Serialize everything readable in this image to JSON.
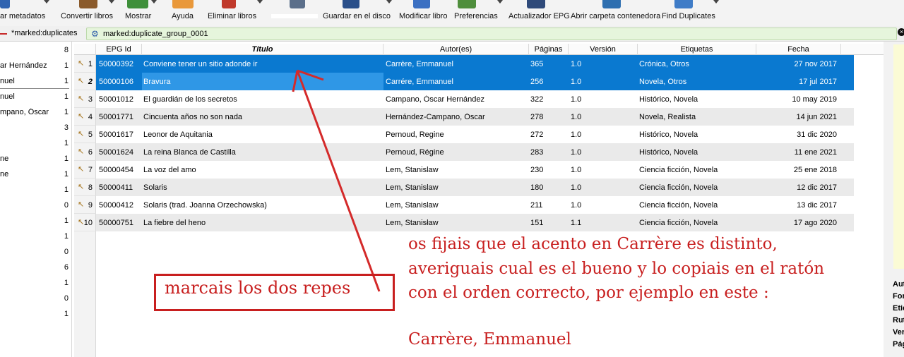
{
  "toolbar": {
    "items": [
      {
        "label": "ar metadatos",
        "icon": "edit-metadata-icon"
      },
      {
        "label": "Convertir libros",
        "icon": "convert-books-icon"
      },
      {
        "label": "Mostrar",
        "icon": "view-book-icon"
      },
      {
        "label": "Ayuda",
        "icon": "help-icon"
      },
      {
        "label": "Eliminar libros",
        "icon": "delete-books-icon"
      },
      {
        "label": "",
        "icon": "device-icon"
      },
      {
        "label": "Guardar en el disco",
        "icon": "save-to-disk-icon"
      },
      {
        "label": "Modificar libro",
        "icon": "edit-book-icon"
      },
      {
        "label": "Preferencias",
        "icon": "preferences-icon"
      },
      {
        "label": "Actualizador EPG",
        "icon": "epg-updater-icon"
      },
      {
        "label": "Abrir carpeta contenedora",
        "icon": "open-folder-icon"
      },
      {
        "label": "Find Duplicates",
        "icon": "find-duplicates-icon"
      }
    ]
  },
  "search": {
    "saved_search": "*marked:duplicates",
    "query": "marked:duplicate_group_0001"
  },
  "tag_browser": {
    "rows": [
      {
        "label": "",
        "count": "8"
      },
      {
        "label": "ar Hernández",
        "count": "1"
      },
      {
        "label": "nuel",
        "count": "1"
      },
      {
        "label": "nuel",
        "count": "1"
      },
      {
        "label": "mpano, Óscar",
        "count": "1"
      },
      {
        "label": "",
        "count": "3"
      },
      {
        "label": "",
        "count": "1"
      },
      {
        "label": "ne",
        "count": "1"
      },
      {
        "label": "ne",
        "count": "1"
      },
      {
        "label": "",
        "count": "1"
      },
      {
        "label": "",
        "count": "0"
      },
      {
        "label": "",
        "count": "1"
      },
      {
        "label": "",
        "count": "1"
      },
      {
        "label": "",
        "count": "0"
      },
      {
        "label": "",
        "count": "6"
      },
      {
        "label": "",
        "count": "1"
      },
      {
        "label": "",
        "count": "0"
      },
      {
        "label": "",
        "count": "1"
      }
    ]
  },
  "table": {
    "columns": [
      "EPG Id",
      "Título",
      "Autor(es)",
      "Páginas",
      "Versión",
      "Etiquetas",
      "Fecha"
    ],
    "sorted_column": "Título",
    "rows": [
      {
        "n": "1",
        "id": "50000392",
        "title": "Conviene tener un sitio adonde ir",
        "author": "Carrère, Emmanuel",
        "pages": "365",
        "version": "1.0",
        "tags": "Crónica, Otros",
        "date": "27 nov 2017",
        "selected": true
      },
      {
        "n": "2",
        "id": "50000106",
        "title": "Bravura",
        "author": "Carrére, Emmanuel",
        "pages": "256",
        "version": "1.0",
        "tags": "Novela, Otros",
        "date": "17 jul 2017",
        "selected": true
      },
      {
        "n": "3",
        "id": "50001012",
        "title": "El guardián de los secretos",
        "author": "Campano, Óscar Hernández",
        "pages": "322",
        "version": "1.0",
        "tags": "Histórico, Novela",
        "date": "10 may 2019",
        "selected": false
      },
      {
        "n": "4",
        "id": "50001771",
        "title": "Cincuenta años no son nada",
        "author": "Hernández-Campano, Óscar",
        "pages": "278",
        "version": "1.0",
        "tags": "Novela, Realista",
        "date": "14 jun 2021",
        "selected": false
      },
      {
        "n": "5",
        "id": "50001617",
        "title": "Leonor de Aquitania",
        "author": "Pernoud, Regine",
        "pages": "272",
        "version": "1.0",
        "tags": "Histórico, Novela",
        "date": "31 dic 2020",
        "selected": false
      },
      {
        "n": "6",
        "id": "50001624",
        "title": "La reina Blanca de Castilla",
        "author": "Pernoud, Régine",
        "pages": "283",
        "version": "1.0",
        "tags": "Histórico, Novela",
        "date": "11 ene 2021",
        "selected": false
      },
      {
        "n": "7",
        "id": "50000454",
        "title": "La voz del amo",
        "author": "Lem, Stanislaw",
        "pages": "230",
        "version": "1.0",
        "tags": "Ciencia ficción, Novela",
        "date": "25 ene 2018",
        "selected": false
      },
      {
        "n": "8",
        "id": "50000411",
        "title": "Solaris",
        "author": "Lem, Stanislaw",
        "pages": "180",
        "version": "1.0",
        "tags": "Ciencia ficción, Novela",
        "date": "12 dic 2017",
        "selected": false
      },
      {
        "n": "9",
        "id": "50000412",
        "title": "Solaris (trad. Joanna Orzechowska)",
        "author": "Lem, Stanislaw",
        "pages": "211",
        "version": "1.0",
        "tags": "Ciencia ficción, Novela",
        "date": "13 dic 2017",
        "selected": false
      },
      {
        "n": "10",
        "id": "50000751",
        "title": "La fiebre del heno",
        "author": "Lem, Stanisław",
        "pages": "151",
        "version": "1.1",
        "tags": "Ciencia ficción, Novela",
        "date": "17 ago 2020",
        "selected": false
      }
    ]
  },
  "book_details": {
    "labels": [
      "Aut",
      "For",
      "Etic",
      "Rut",
      "Ver",
      "Pág"
    ]
  },
  "annotation": {
    "box_text": "marcais los dos repes",
    "note_lines": [
      "os fijais que el acento en Carrère es distinto,",
      "averiguais cual es el bueno y lo copiais en el ratón",
      "con el orden correcto, por ejemplo en este :",
      "",
      "Carrère, Emmanuel"
    ],
    "color": "#c81f1f"
  },
  "colors": {
    "selection": "#0a79d0",
    "search_bg": "#e6f5dc",
    "annotation": "#c81f1f"
  }
}
